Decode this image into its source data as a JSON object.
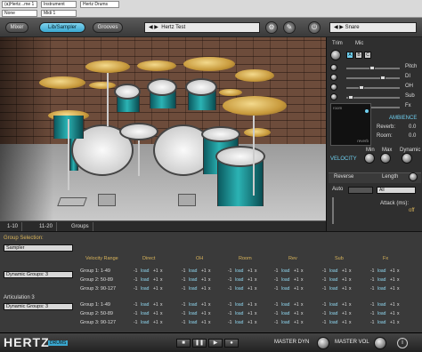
{
  "host": {
    "slot": "(a)Hertz...me 1",
    "preset": "None",
    "instrument": "Instrument",
    "midi": "Midi 1",
    "plugin": "Hertz Drums"
  },
  "topbar": {
    "tabs": [
      "Mixer",
      "Lib/Sampler",
      "Grooves"
    ],
    "active_tab": "Lib/Sampler",
    "kit_name": "Hertz Test",
    "instrument_name": "Snare",
    "accent": "#3aa7cf"
  },
  "kit_tabs": [
    "1-10",
    "11-20",
    "Groups"
  ],
  "right_panel": {
    "trim": "Trim",
    "mic": "Mic",
    "mic_buttons": [
      "A",
      "B",
      "C"
    ],
    "channels": [
      "Pitch",
      "DI",
      "OH",
      "Sub",
      "Fx"
    ],
    "ambience": "AMBIENCE",
    "room_label": "room",
    "reverb_label": "reverb",
    "reverb": "Reverb:",
    "reverb_val": "0.0",
    "room": "Room:",
    "room_val": "0.0",
    "velocity": "VELOCITY",
    "min": "Min",
    "max": "Max",
    "dynamic": "Dynamic",
    "reverse": "Reverse",
    "length": "Length",
    "auto": "Auto",
    "group_value": "All",
    "attack": "Attack (ms):",
    "attack_val": "off"
  },
  "bottom": {
    "group_selection": "Group Selection:",
    "sampler": "Sampler",
    "dyn_groups_a": "Dynamic Groups: 3",
    "articulation": "Articulation 3",
    "dyn_groups_b": "Dynamic Groups: 3",
    "headers": [
      "Velocity Range",
      "Direct",
      "OH",
      "Room",
      "Rev",
      "Sub",
      "Fx"
    ],
    "rows_a": [
      "Group 1: 1-49",
      "Group 2: 50-89",
      "Group 3: 90-127"
    ],
    "rows_b": [
      "Group 1: 1-49",
      "Group 2: 50-89",
      "Group 3: 90-127"
    ],
    "cell": {
      "minus": "-1",
      "load": "load",
      "plus": "+1",
      "x": "x"
    }
  },
  "footer": {
    "logo": "HERTZ",
    "logo_sub": "DRUMS",
    "master_dyn": "MASTER DYN",
    "master_vol": "MASTER VOL",
    "info": "i"
  }
}
